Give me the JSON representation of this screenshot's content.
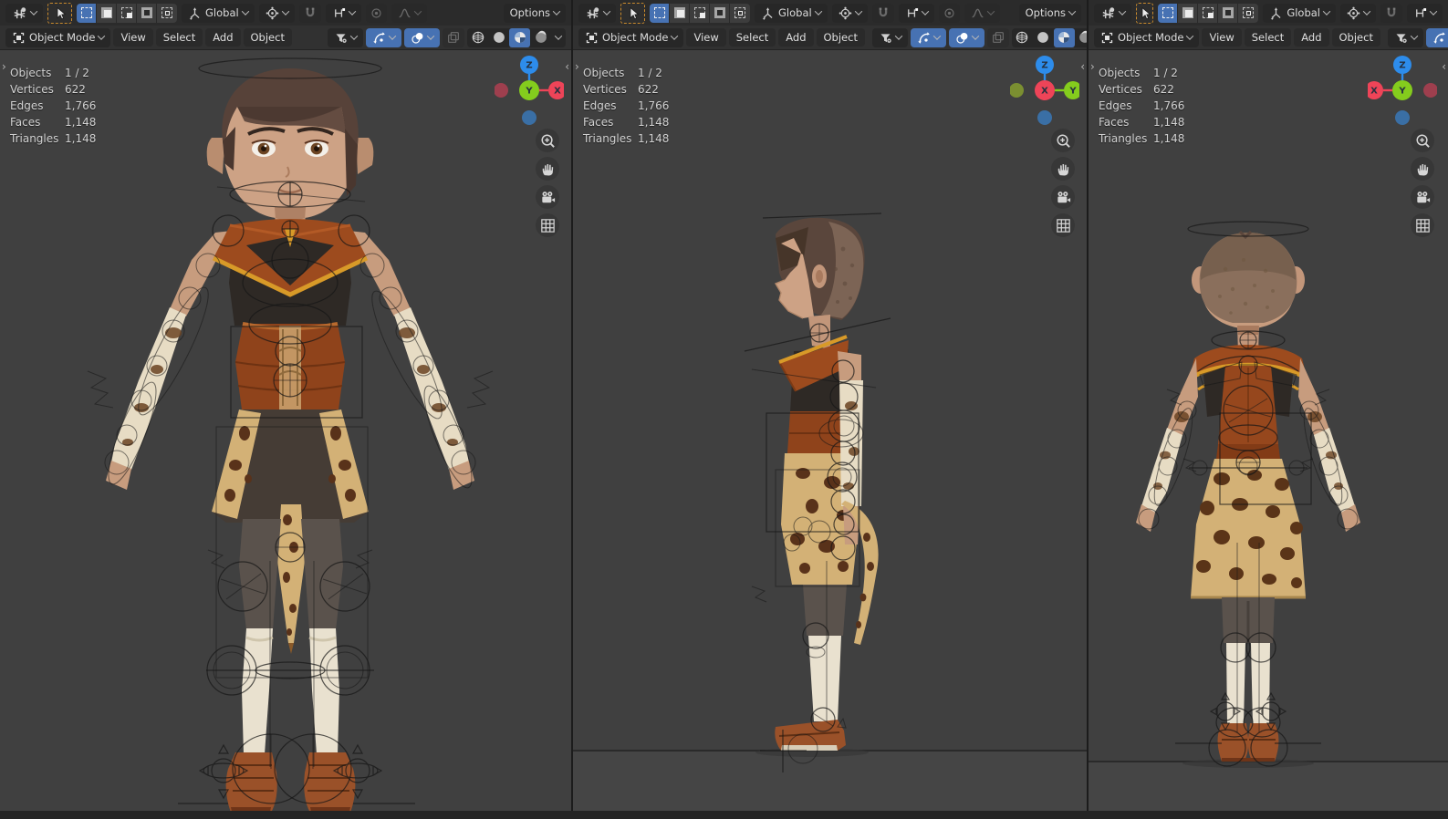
{
  "header": {
    "transform_orientation": "Global",
    "mode": "Object Mode",
    "menus": [
      "View",
      "Select",
      "Add",
      "Object"
    ],
    "options_label": "Options"
  },
  "stats": {
    "rows": [
      {
        "label": "Objects",
        "value": "1 / 2"
      },
      {
        "label": "Vertices",
        "value": "622"
      },
      {
        "label": "Edges",
        "value": "1,766"
      },
      {
        "label": "Faces",
        "value": "1,148"
      },
      {
        "label": "Triangles",
        "value": "1,148"
      }
    ]
  },
  "viewports": [
    {
      "name": "front",
      "gizmo": {
        "up": "Z",
        "center": "Y",
        "side": "X"
      }
    },
    {
      "name": "side",
      "gizmo": {
        "up": "Z",
        "center": "X",
        "side": "Y"
      }
    },
    {
      "name": "back",
      "gizmo": {
        "up": "Z",
        "center": "Y",
        "side": "X"
      }
    }
  ],
  "colors": {
    "accent_blue": "#4772b3",
    "tool_active_orange": "#c98a2d",
    "axis_x": "#ee4458",
    "axis_y": "#84cc1d",
    "axis_z": "#2d8ceb",
    "axis_x_dim": "#9e3f4e",
    "axis_y_dim": "#7b8f31",
    "axis_z_dim": "#3a6fa5",
    "viewport_bg": "#404040"
  },
  "icon_names": [
    "editor-type-3d-viewport",
    "tool-select-box",
    "select-mode-set",
    "select-mode-extend",
    "select-mode-subtract",
    "select-mode-invert",
    "select-mode-intersect",
    "orientation-axis",
    "pivot-point",
    "snap-magnet",
    "snap-target",
    "proportional-editing",
    "falloff-curve",
    "object-mode",
    "filter-visibility",
    "viewport-gizmos",
    "overlays",
    "toggle-xray",
    "shading-wireframe",
    "shading-solid",
    "shading-material",
    "shading-rendered",
    "zoom",
    "pan-hand",
    "camera-view",
    "grid-ortho"
  ]
}
